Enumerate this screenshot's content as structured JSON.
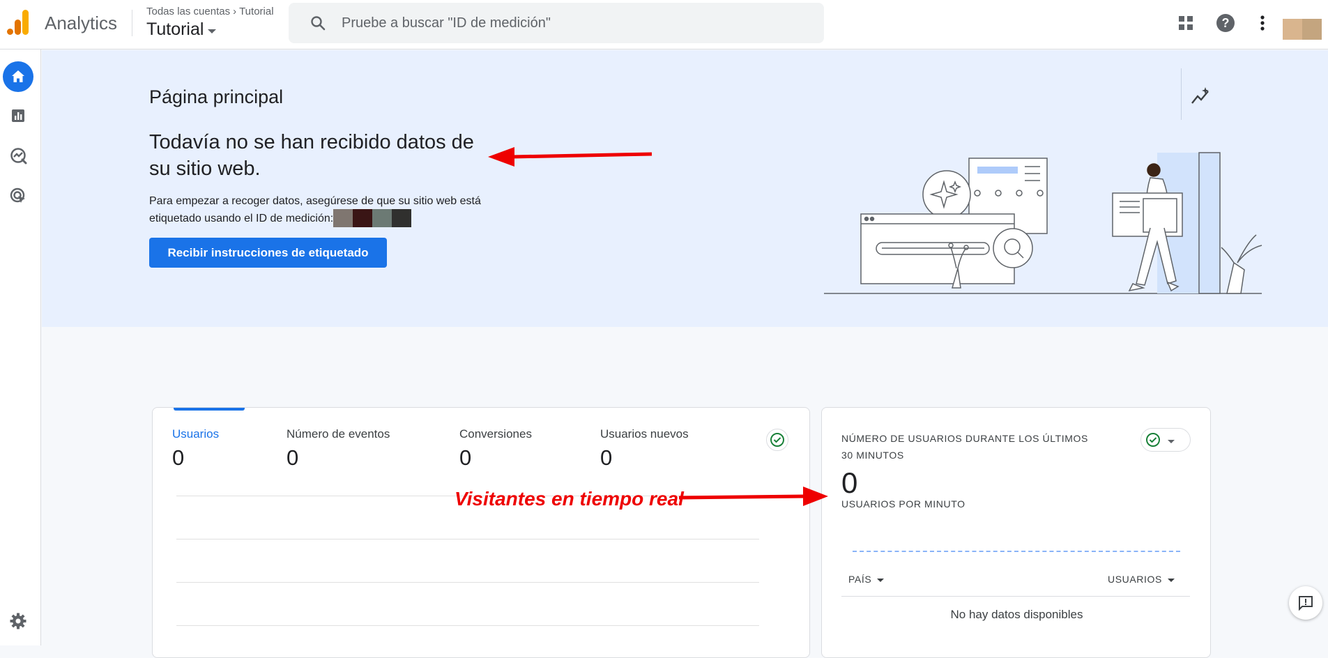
{
  "header": {
    "brand": "Analytics",
    "breadcrumb": [
      "Todas las cuentas",
      "Tutorial"
    ],
    "property_name": "Tutorial",
    "search_placeholder": "Pruebe a buscar \"ID de medición\"",
    "icons": [
      "apps-grid-icon",
      "help-icon",
      "more-vert-icon"
    ]
  },
  "nav": {
    "items": [
      "home-icon",
      "reports-icon",
      "explore-icon",
      "advertising-icon"
    ],
    "bottom": "settings-icon"
  },
  "hero": {
    "page_title": "Página principal",
    "headline": "Todavía no se han recibido datos de su sitio web.",
    "description": "Para empezar a recoger datos, asegúrese de que su sitio web está etiquetado usando el ID de medición:",
    "button_label": "Recibir instrucciones de etiquetado"
  },
  "annotations": {
    "realtime_label": "Visitantes en tiempo real"
  },
  "metrics": {
    "items": [
      {
        "label": "Usuarios",
        "value": "0"
      },
      {
        "label": "Número de eventos",
        "value": "0"
      },
      {
        "label": "Conversiones",
        "value": "0"
      },
      {
        "label": "Usuarios nuevos",
        "value": "0"
      }
    ]
  },
  "realtime": {
    "title": "NÚMERO DE USUARIOS DURANTE LOS ÚLTIMOS 30 MINUTOS",
    "value": "0",
    "subtitle": "USUARIOS POR MINUTO",
    "col_country": "PAÍS",
    "col_users": "USUARIOS",
    "empty": "No hay datos disponibles"
  },
  "colors": {
    "accent": "#1a73e8",
    "hero_bg": "#e8f0fe",
    "annotation": "#ee0000",
    "success": "#188038"
  }
}
